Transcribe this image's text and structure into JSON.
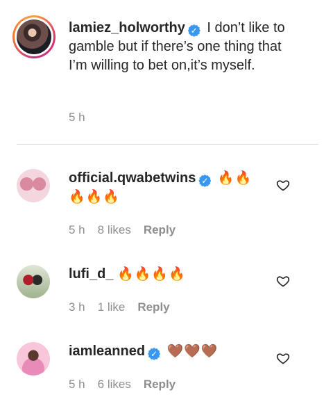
{
  "caption": {
    "username": "lamiez_holworthy",
    "text": "I don’t like to gamble but if there’s one thing that I’m willing to bet on,it’s myself.",
    "time": "5 h"
  },
  "comments": [
    {
      "username": "official.qwabetwins",
      "verified": true,
      "text": "🔥🔥🔥🔥🔥",
      "time": "5 h",
      "likes": "8 likes",
      "reply": "Reply"
    },
    {
      "username": "lufi_d_",
      "verified": false,
      "text": "🔥🔥🔥🔥",
      "time": "3 h",
      "likes": "1 like",
      "reply": "Reply"
    },
    {
      "username": "iamleanned",
      "verified": true,
      "text": "🤎🤎🤎",
      "time": "5 h",
      "likes": "6 likes",
      "reply": "Reply"
    }
  ],
  "icons": {
    "verified": "verified-badge-icon",
    "like": "heart-outline-icon"
  },
  "colors": {
    "verified": "#3897f0",
    "meta": "#8e8e8e",
    "text": "#262626"
  }
}
